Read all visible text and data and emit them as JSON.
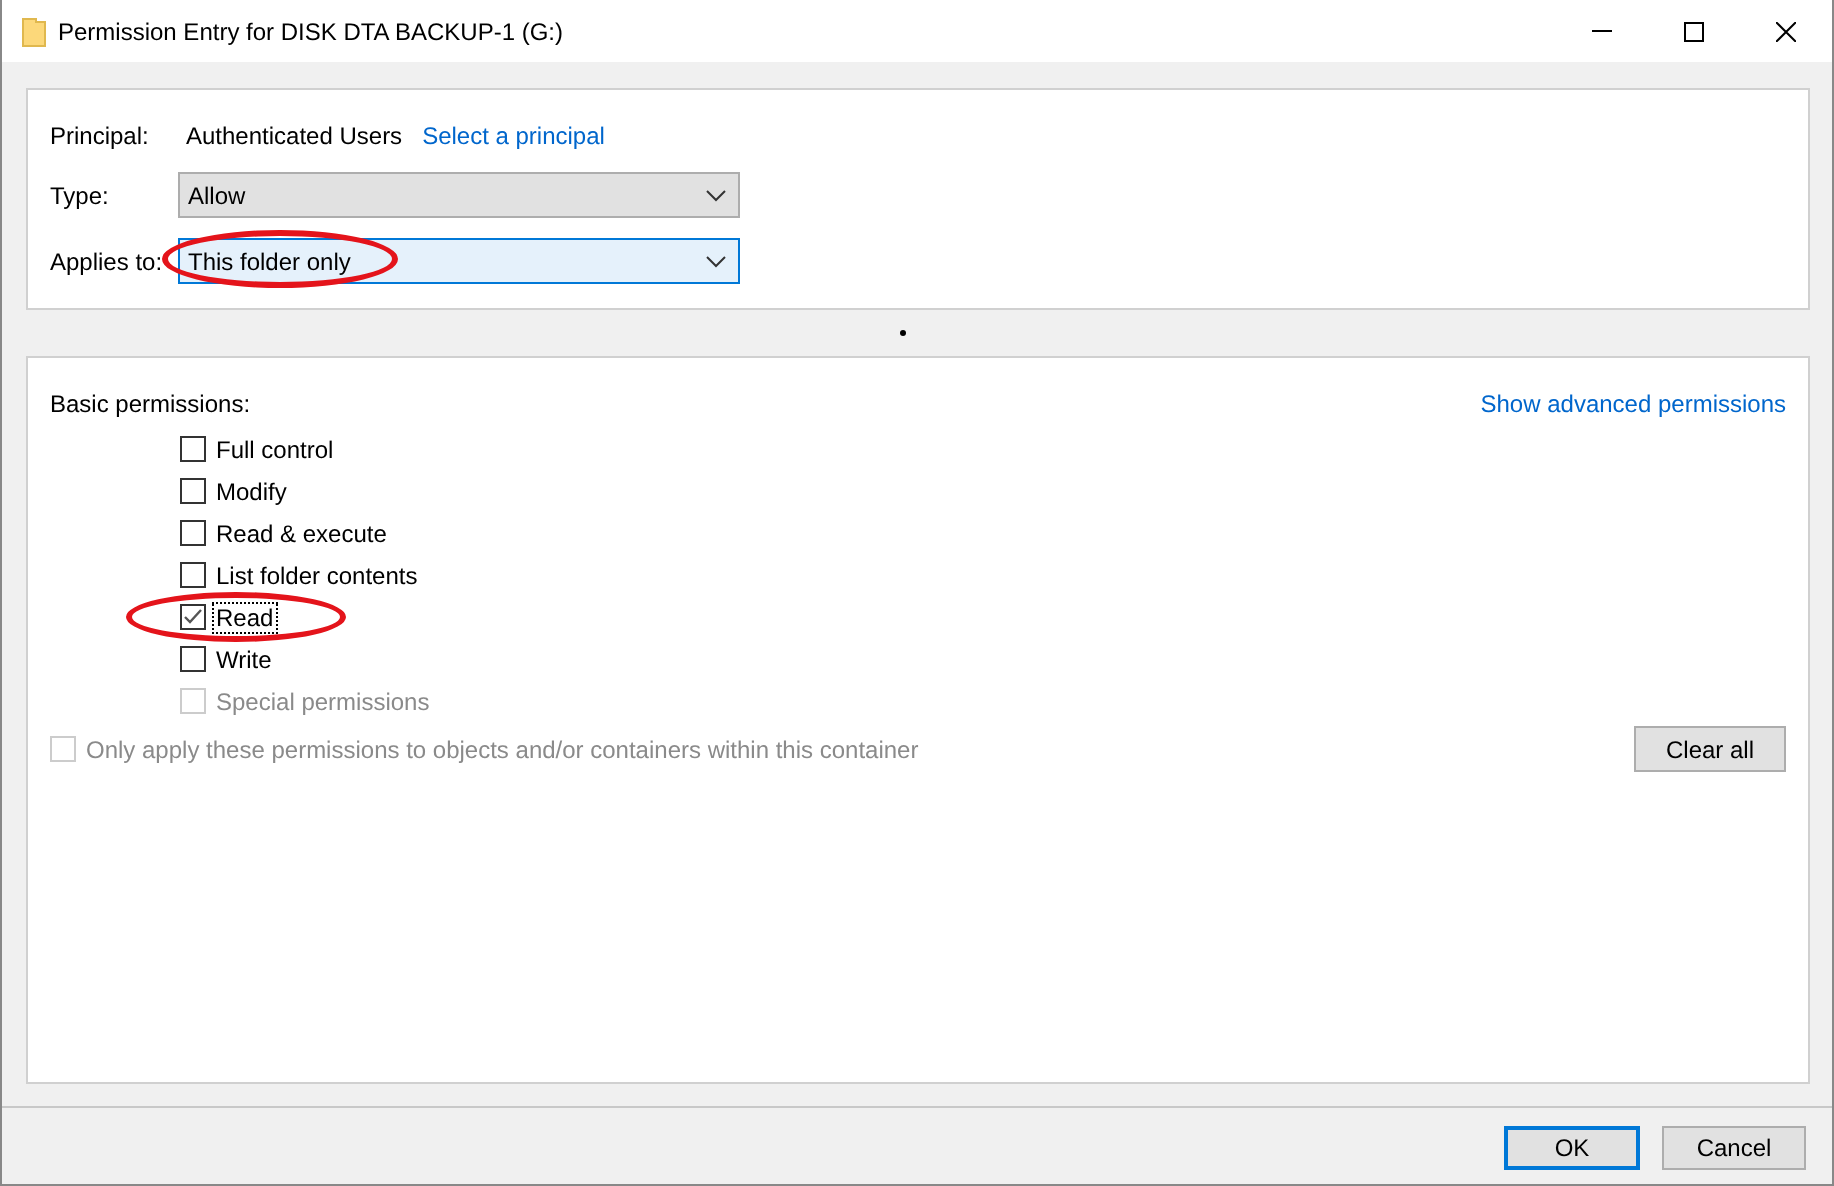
{
  "window": {
    "title": "Permission Entry for DISK DTA BACKUP-1 (G:)"
  },
  "principal": {
    "label": "Principal:",
    "value": "Authenticated Users",
    "link": "Select a principal"
  },
  "fields": [
    {
      "label": "Type:",
      "value": "Allow",
      "focused": false,
      "highlighted": false
    },
    {
      "label": "Applies to:",
      "value": "This folder only",
      "focused": true,
      "highlighted": true
    }
  ],
  "permissions": {
    "heading": "Basic permissions:",
    "link": "Show advanced permissions",
    "items": [
      {
        "label": "Full control",
        "checked": false,
        "disabled": false,
        "focused": false,
        "highlighted": false
      },
      {
        "label": "Modify",
        "checked": false,
        "disabled": false,
        "focused": false,
        "highlighted": false
      },
      {
        "label": "Read & execute",
        "checked": false,
        "disabled": false,
        "focused": false,
        "highlighted": false
      },
      {
        "label": "List folder contents",
        "checked": false,
        "disabled": false,
        "focused": false,
        "highlighted": false
      },
      {
        "label": "Read",
        "checked": true,
        "disabled": false,
        "focused": true,
        "highlighted": true
      },
      {
        "label": "Write",
        "checked": false,
        "disabled": false,
        "focused": false,
        "highlighted": false
      },
      {
        "label": "Special permissions",
        "checked": false,
        "disabled": true,
        "focused": false,
        "highlighted": false
      }
    ]
  },
  "only_apply": {
    "label": "Only apply these permissions to objects and/or containers within this container",
    "checked": false,
    "disabled": true
  },
  "clear_button": {
    "label": "Clear all"
  },
  "buttons": [
    {
      "label": "OK",
      "default": true
    },
    {
      "label": "Cancel",
      "default": false
    }
  ]
}
